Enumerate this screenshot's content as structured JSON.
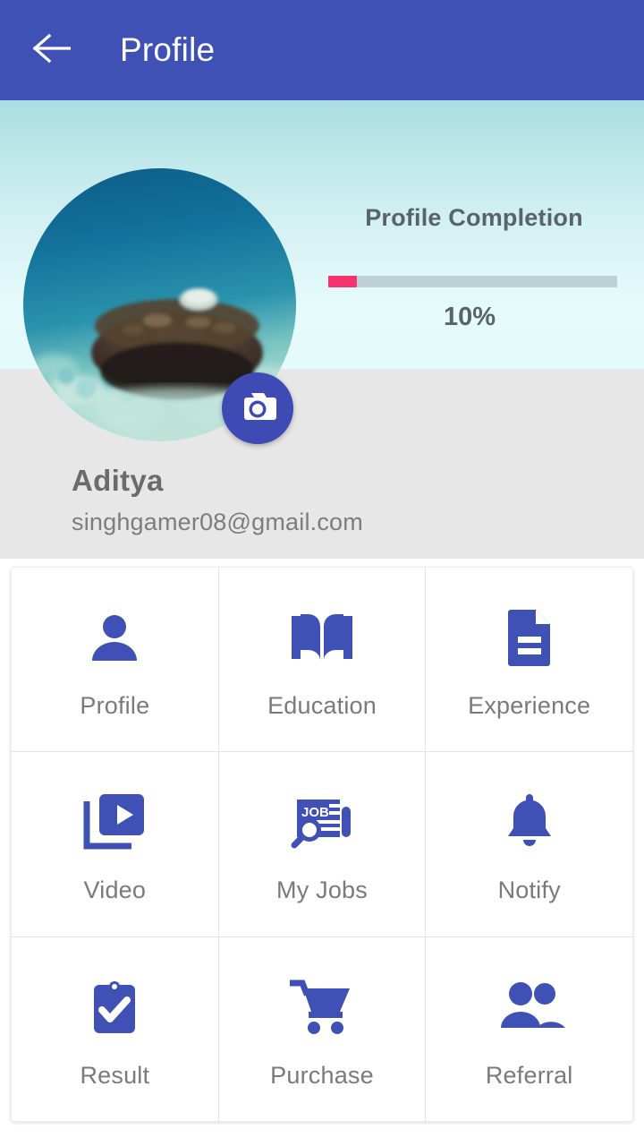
{
  "appbar": {
    "back_icon": "arrow-left-icon",
    "title": "Profile",
    "background": "#3f51b5"
  },
  "hero": {
    "avatar_alt": "user-photo",
    "camera_icon": "camera-icon"
  },
  "completion": {
    "title": "Profile Completion",
    "percent_label": "10%",
    "percent_value": 10,
    "fill_color": "#f5336f",
    "track_color": "#bfd2d3"
  },
  "identity": {
    "name": "Aditya",
    "email": "singhgamer08@gmail.com"
  },
  "menu": {
    "rows": [
      [
        {
          "label": "Profile",
          "icon": "person-icon"
        },
        {
          "label": "Education",
          "icon": "open-book-icon"
        },
        {
          "label": "Experience",
          "icon": "document-icon"
        }
      ],
      [
        {
          "label": "Video",
          "icon": "video-library-icon"
        },
        {
          "label": "My Jobs",
          "icon": "job-search-icon"
        },
        {
          "label": "Notify",
          "icon": "bell-icon"
        }
      ],
      [
        {
          "label": "Result",
          "icon": "clipboard-check-icon"
        },
        {
          "label": "Purchase",
          "icon": "shopping-cart-icon"
        },
        {
          "label": "Referral",
          "icon": "people-icon"
        }
      ]
    ],
    "icon_color": "#3f51b5"
  }
}
